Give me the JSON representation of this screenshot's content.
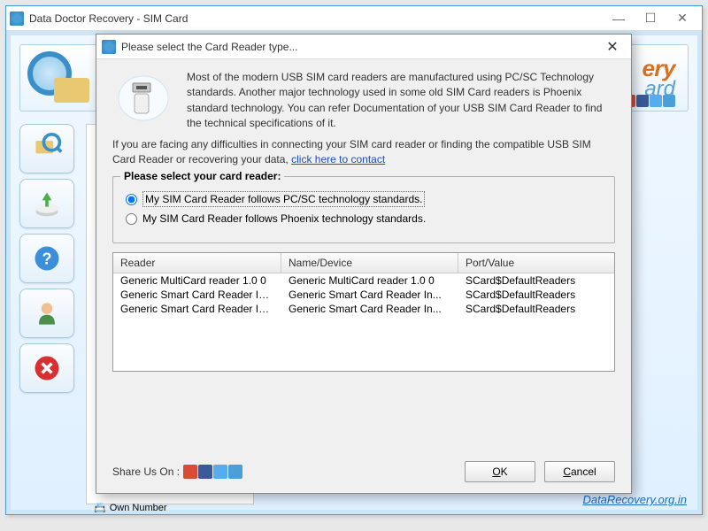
{
  "outer": {
    "title": "Data Doctor Recovery - SIM Card",
    "banner_t1": "ery",
    "banner_t2": "ard",
    "tree_item": "Own Number",
    "footer_link": "DataRecovery.org.in"
  },
  "modal": {
    "title": "Please select the Card Reader type...",
    "info1": "Most of the modern USB SIM card readers are manufactured using PC/SC Technology standards. Another major technology used in some old SIM Card readers is Phoenix standard technology. You can refer Documentation of your USB SIM Card Reader to find the technical specifications of it.",
    "info2_a": "If you are facing any difficulties in connecting your SIM card reader or finding the compatible USB SIM Card Reader or recovering your data,   ",
    "info2_link": "click here to contact ",
    "legend": "Please select your card reader:",
    "radio1": "My SIM Card Reader follows PC/SC technology standards.",
    "radio2": "My SIM Card Reader follows Phoenix technology standards.",
    "columns": {
      "c1": "Reader",
      "c2": "Name/Device",
      "c3": "Port/Value"
    },
    "rows": [
      {
        "reader": "Generic MultiCard reader 1.0 0",
        "name": "Generic MultiCard reader 1.0 0",
        "port": "SCard$DefaultReaders"
      },
      {
        "reader": "Generic Smart Card Reader Int...",
        "name": "Generic Smart Card Reader In...",
        "port": "SCard$DefaultReaders"
      },
      {
        "reader": "Generic Smart Card Reader Int...",
        "name": "Generic Smart Card Reader In...",
        "port": "SCard$DefaultReaders"
      }
    ],
    "share_label": "Share Us On :",
    "ok": "OK",
    "cancel": "Cancel"
  }
}
